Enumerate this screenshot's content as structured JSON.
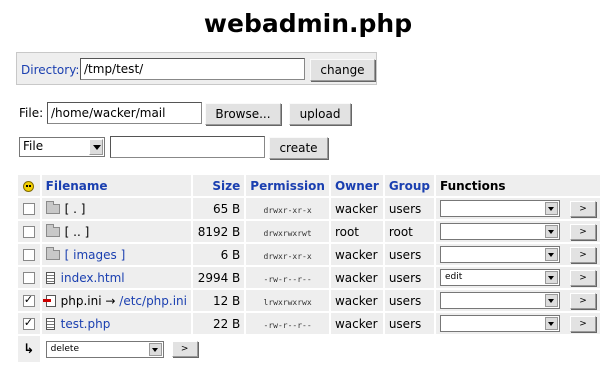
{
  "title": "webadmin.php",
  "directory": {
    "label": "Directory:",
    "value": "/tmp/test/",
    "button": "change"
  },
  "upload": {
    "label": "File:",
    "value": "/home/wacker/mail",
    "browse": "Browse...",
    "button": "upload"
  },
  "create": {
    "type_selected": "File",
    "name_value": "",
    "button": "create"
  },
  "table": {
    "headers": {
      "filename": "Filename",
      "size": "Size",
      "permission": "Permission",
      "owner": "Owner",
      "group": "Group",
      "functions": "Functions"
    },
    "rows": [
      {
        "checked": false,
        "icon": "folder-icon",
        "name": "[ . ]",
        "link": false,
        "size": "65 B",
        "perm": "drwxr-xr-x",
        "owner": "wacker",
        "group": "users",
        "function": ""
      },
      {
        "checked": false,
        "icon": "folder-icon",
        "name": "[ .. ]",
        "link": false,
        "size": "8192 B",
        "perm": "drwxrwxrwt",
        "owner": "root",
        "group": "root",
        "function": ""
      },
      {
        "checked": false,
        "icon": "folder-icon",
        "name": "[ images ]",
        "link": true,
        "size": "6 B",
        "perm": "drwxr-xr-x",
        "owner": "wacker",
        "group": "users",
        "function": ""
      },
      {
        "checked": false,
        "icon": "file-icon",
        "name": "index.html",
        "link": true,
        "size": "2994 B",
        "perm": "-rw-r--r--",
        "owner": "wacker",
        "group": "users",
        "function": "edit"
      },
      {
        "checked": true,
        "icon": "symlink-icon",
        "name": "php.ini",
        "target_arrow": "→",
        "target": "/etc/php.ini",
        "link": false,
        "size": "12 B",
        "perm": "lrwxrwxrwx",
        "owner": "wacker",
        "group": "users",
        "function": ""
      },
      {
        "checked": true,
        "icon": "file-icon",
        "name": "test.php",
        "link": true,
        "size": "22 B",
        "perm": "-rw-r--r--",
        "owner": "wacker",
        "group": "users",
        "function": ""
      }
    ],
    "go_label": ">",
    "bulk": {
      "arrow": "↳",
      "action": "delete",
      "go_label": ">"
    }
  }
}
